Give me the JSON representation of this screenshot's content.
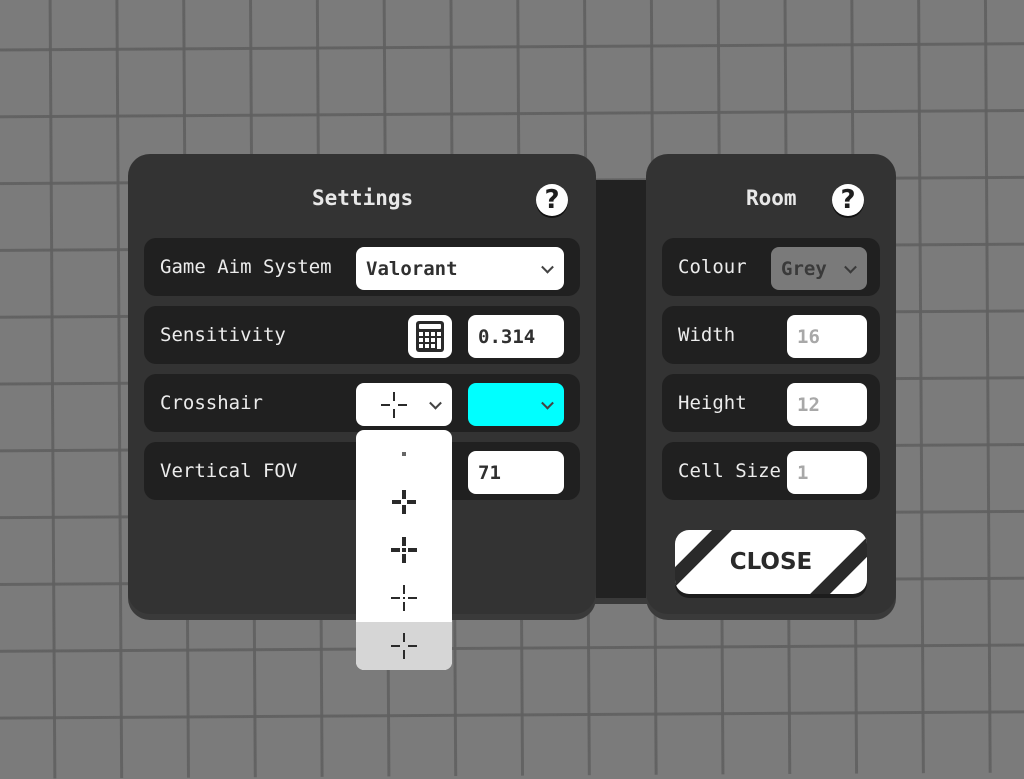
{
  "settings": {
    "title": "Settings",
    "help_icon": "?",
    "rows": {
      "game_aim_system": {
        "label": "Game Aim System",
        "value": "Valorant"
      },
      "sensitivity": {
        "label": "Sensitivity",
        "value": "0.314",
        "calculator_icon": "calculator-icon"
      },
      "crosshair": {
        "label": "Crosshair",
        "style_selected": "thin-gap-cross",
        "color": "#00ffff",
        "options": [
          "dot",
          "bold-gap-cross",
          "bold-cross-dot",
          "thin-cross-dot",
          "thin-gap-cross"
        ],
        "selected_option_index": 4
      },
      "vertical_fov": {
        "label": "Vertical FOV",
        "value": "71"
      }
    }
  },
  "room": {
    "title": "Room",
    "help_icon": "?",
    "rows": {
      "colour": {
        "label": "Colour",
        "value": "Grey"
      },
      "width": {
        "label": "Width",
        "placeholder": "16"
      },
      "height": {
        "label": "Height",
        "placeholder": "12"
      },
      "cell_size": {
        "label": "Cell Size",
        "placeholder": "1"
      }
    },
    "close_label": "CLOSE"
  },
  "colors": {
    "panel": "#333333",
    "row": "#202020",
    "background": "#7b7b7b",
    "crosshair": "#00ffff",
    "colour_select": "#7a7a7a"
  }
}
